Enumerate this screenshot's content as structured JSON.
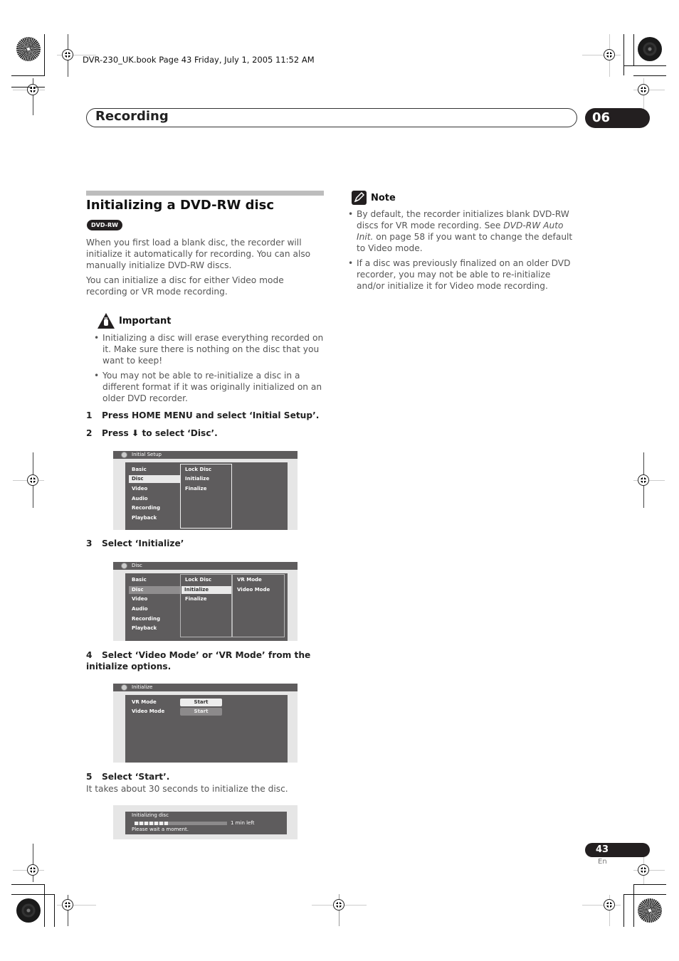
{
  "print_header": {
    "meta": "DVR-230_UK.book  Page 43  Friday, July 1, 2005  11:52 AM"
  },
  "chapter": {
    "title": "Recording",
    "number": "06"
  },
  "section": {
    "title": "Initializing a DVD-RW disc",
    "badge": "DVD-RW",
    "intro_1": "When you first load a blank disc, the recorder will initialize it automatically for recording. You can also manually initialize DVD-RW discs.",
    "intro_2": "You can initialize a disc for either Video mode recording or VR mode recording."
  },
  "important": {
    "label": "Important",
    "icon": "warning-hand-icon",
    "bullets": [
      "Initializing a disc will erase everything recorded on it. Make sure there is nothing on the disc that you want to keep!",
      "You may not be able to re-initialize a disc in a different format if it was originally initialized on an older DVD recorder."
    ]
  },
  "steps": [
    {
      "num": "1",
      "text": "Press HOME MENU and select ‘Initial Setup’."
    },
    {
      "num": "2",
      "text_before": "Press",
      "arrow": "⬇",
      "text_after": "to select ‘Disc’."
    },
    {
      "num": "3",
      "text": "Select ‘Initialize’"
    },
    {
      "num": "4",
      "text": "Select ‘Video Mode’ or ‘VR Mode’ from the initialize options."
    },
    {
      "num": "5",
      "text": "Select ‘Start’.",
      "detail": "It takes about 30 seconds to initialize the disc."
    }
  ],
  "screen1": {
    "title": "Initial Setup",
    "menu": [
      "Basic",
      "Disc",
      "Video",
      "Audio",
      "Recording",
      "Playback"
    ],
    "selected_menu": "Disc",
    "submenu": [
      "Lock Disc",
      "Initialize",
      "Finalize"
    ]
  },
  "screen2": {
    "title": "Disc",
    "menu": [
      "Basic",
      "Disc",
      "Video",
      "Audio",
      "Recording",
      "Playback"
    ],
    "selected_menu": "Disc",
    "submenu": [
      "Lock Disc",
      "Initialize",
      "Finalize"
    ],
    "selected_submenu": "Initialize",
    "options": [
      "VR Mode",
      "Video Mode"
    ]
  },
  "screen3": {
    "title": "Initialize",
    "rows": [
      {
        "label": "VR Mode",
        "button": "Start",
        "active": true
      },
      {
        "label": "Video Mode",
        "button": "Start",
        "active": false
      }
    ]
  },
  "screen4": {
    "title": "Initializing disc",
    "progress_fraction": 0.38,
    "progress_segments": 7,
    "remaining": "1 min left",
    "message": "Please wait a moment."
  },
  "note": {
    "label": "Note",
    "icon": "pencil-note-icon",
    "bullet_1_before": "By default, the recorder initializes blank DVD-RW discs for VR mode recording. See ",
    "bullet_1_italic": "DVD-RW Auto Init.",
    "bullet_1_after": " on page 58 if you want to change the default to Video mode.",
    "bullet_2": "If a disc was previously finalized on an older DVD recorder, you may not be able to re-initialize and/or initialize it for Video mode recording."
  },
  "footer": {
    "page_number": "43",
    "language": "En"
  }
}
